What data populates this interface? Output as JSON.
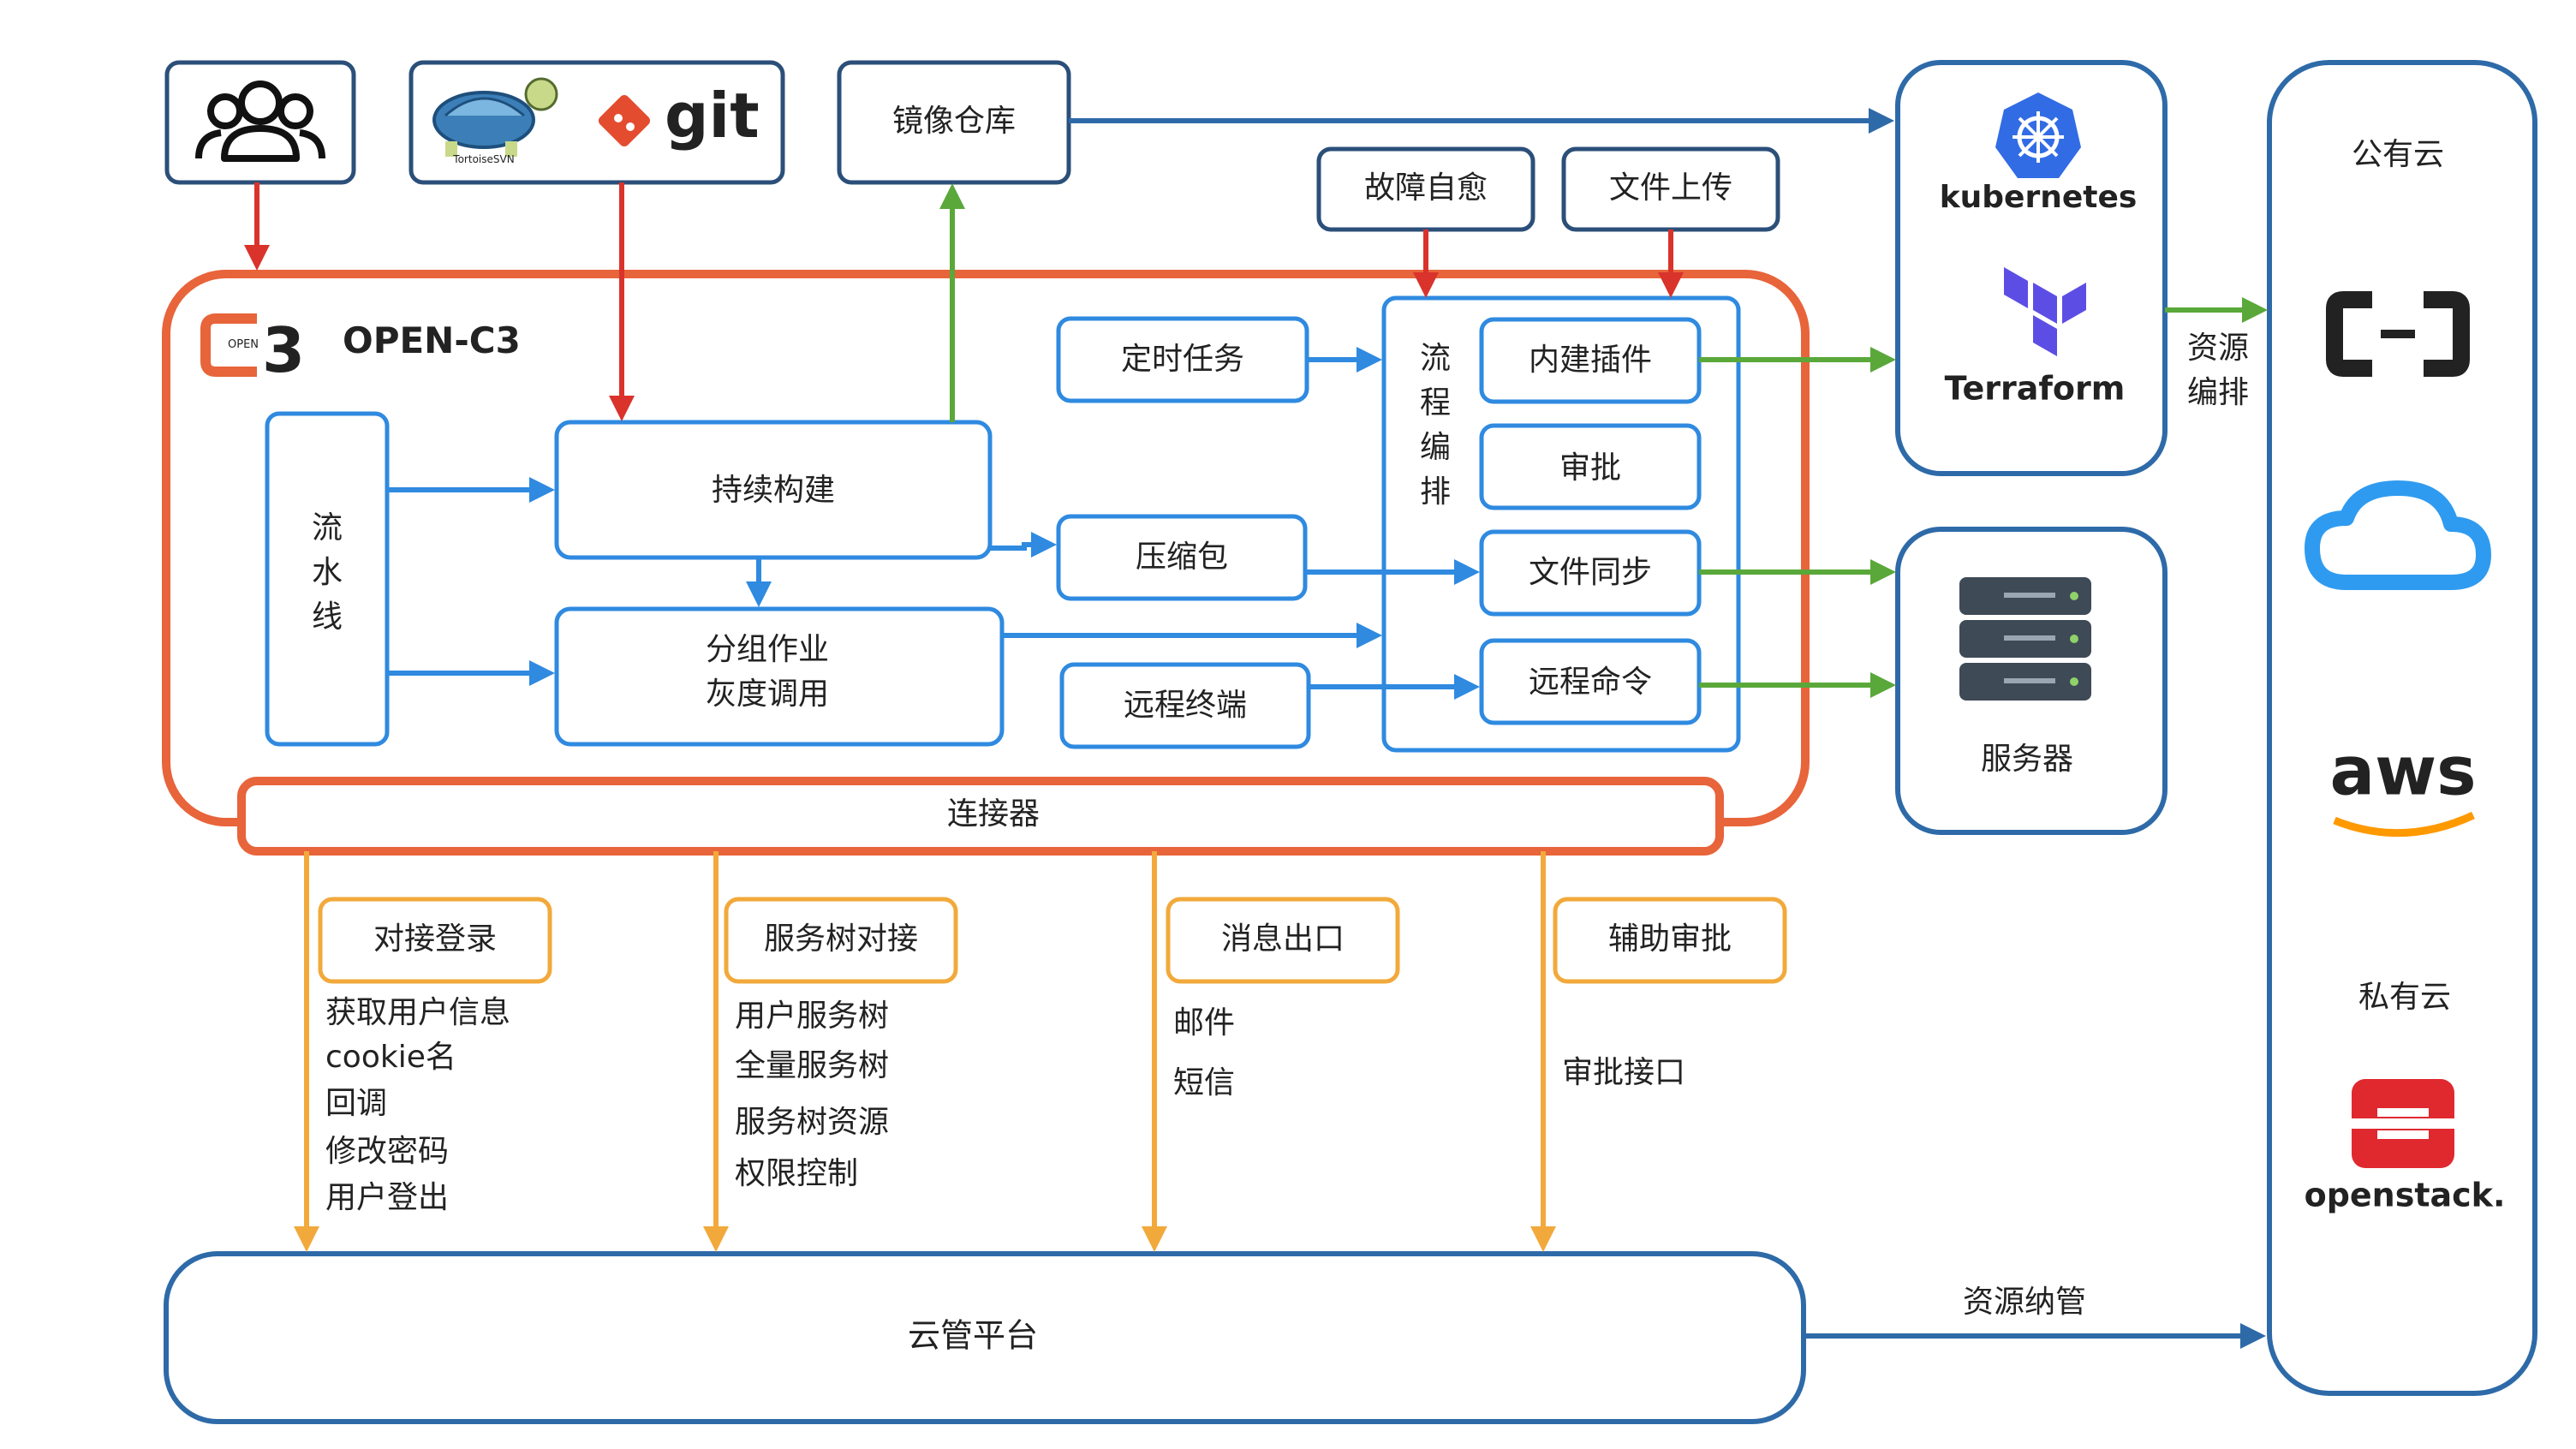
{
  "colors": {
    "navy": "#2b4f79",
    "blue_box": "#2f8ae0",
    "blue_arrow": "#2f8ae0",
    "orange": "#e8643a",
    "red": "#d9332b",
    "green": "#5aa83a",
    "yellow": "#f2a93b",
    "dark_arrow": "#2e6aa8"
  },
  "top": {
    "users_icon": "users-icon",
    "tortoise_logo": "tortoisesvn-logo",
    "tortoise_caption": "TortoiseSVN",
    "git_label": "git",
    "registry": "镜像仓库",
    "self_heal": "故障自愈",
    "file_upload": "文件上传"
  },
  "platform": {
    "logo_text": "OPEN-C3",
    "logo_badge": "OPEN",
    "pipeline": [
      "流",
      "水",
      "线"
    ],
    "ci": "持续构建",
    "group_job": [
      "分组作业",
      "灰度调用"
    ],
    "package": "压缩包",
    "cron": "定时任务",
    "terminal": "远程终端",
    "orchestration": [
      "流",
      "程",
      "编",
      "排"
    ],
    "plugin": "内建插件",
    "approval": "审批",
    "file_sync": "文件同步",
    "remote_cmd": "远程命令",
    "connector": "连接器"
  },
  "targets": {
    "kubernetes": "kubernetes",
    "terraform": "Terraform",
    "resource_orch": [
      "资源",
      "编排"
    ],
    "servers": "服务器"
  },
  "clouds": {
    "public": "公有云",
    "private": "私有云",
    "aliyun_icon": "aliyun-icon",
    "tencent_icon": "tencent-cloud-icon",
    "aws": "aws",
    "openstack": "openstack."
  },
  "connectors": [
    {
      "title": "对接登录",
      "items": [
        "获取用户信息",
        "cookie名",
        "回调",
        "修改密码",
        "用户登出"
      ]
    },
    {
      "title": "服务树对接",
      "items": [
        "用户服务树",
        "全量服务树",
        "服务树资源",
        "权限控制"
      ]
    },
    {
      "title": "消息出口",
      "items": [
        "邮件",
        "短信"
      ]
    },
    {
      "title": "辅助审批",
      "items": [
        "审批接口"
      ]
    }
  ],
  "bottom": {
    "cloud_platform": "云管平台",
    "resource_mgmt": "资源纳管"
  }
}
